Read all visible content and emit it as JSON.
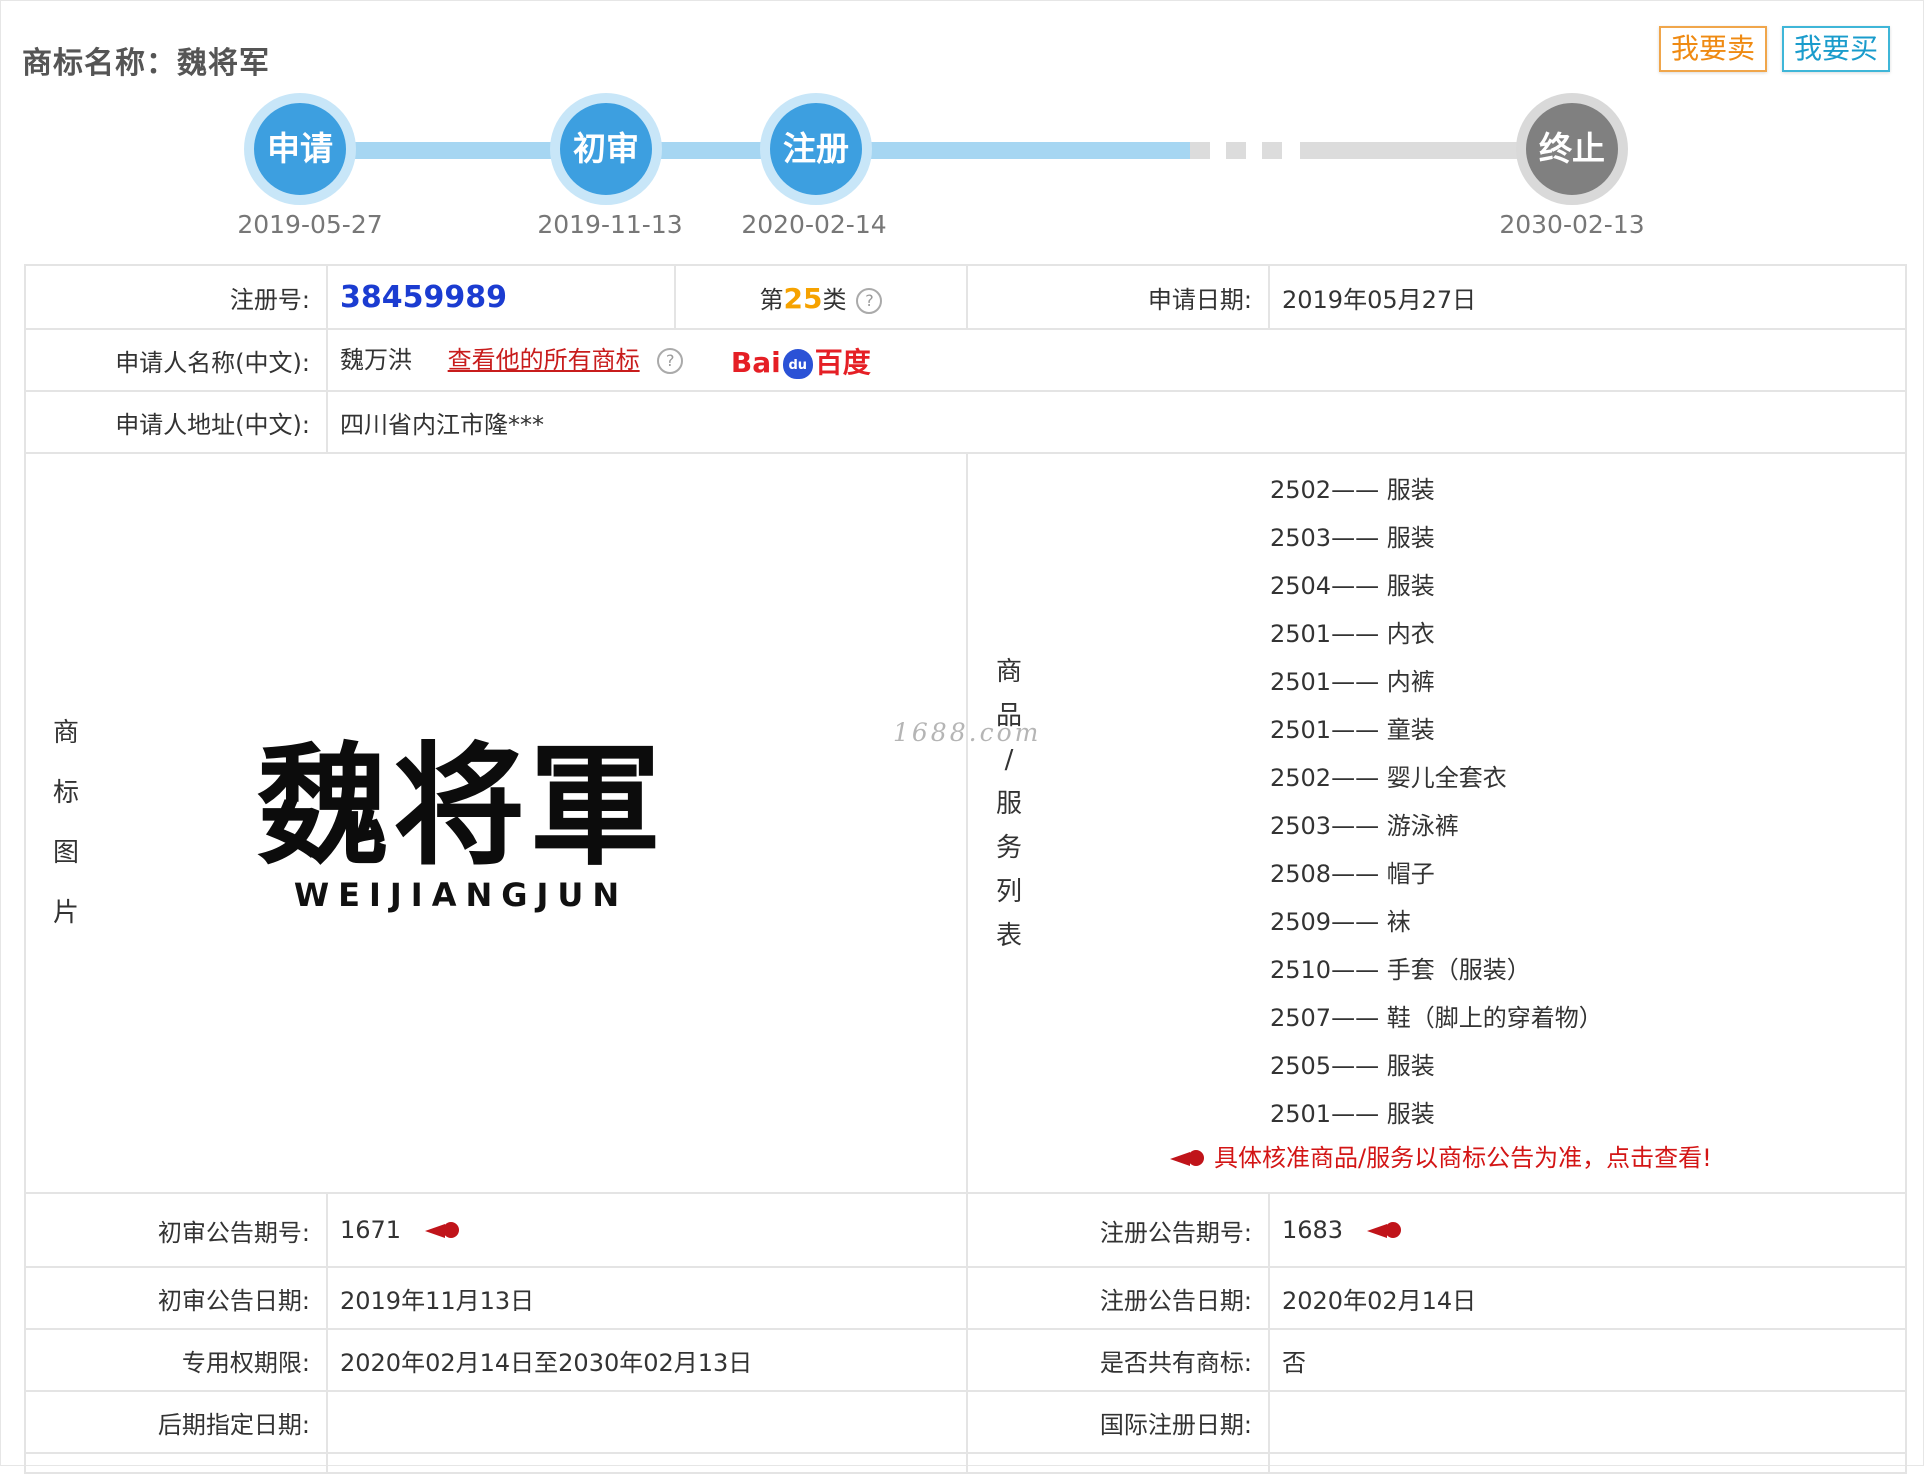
{
  "header": {
    "title": "商标名称：魏将军",
    "sell_button": "我要卖",
    "buy_button": "我要买"
  },
  "timeline": {
    "steps": [
      {
        "label": "申请",
        "date": "2019-05-27"
      },
      {
        "label": "初审",
        "date": "2019-11-13"
      },
      {
        "label": "注册",
        "date": "2020-02-14"
      },
      {
        "label": "终止",
        "date": "2030-02-13"
      }
    ]
  },
  "info": {
    "reg_no_label": "注册号:",
    "reg_no": "38459989",
    "class_prefix": "第",
    "class_num": "25",
    "class_suffix": "类",
    "help_icon": "?",
    "apply_date_label": "申请日期:",
    "apply_date": "2019年05月27日",
    "applicant_label": "申请人名称(中文):",
    "applicant": "魏万洪",
    "applicant_link": "查看他的所有商标",
    "baidu_text_left": "Bai",
    "baidu_paw": "du",
    "baidu_text_right": "百度",
    "address_label": "申请人地址(中文):",
    "address": "四川省内江市隆***",
    "image_label": [
      "商",
      "标",
      "图",
      "片"
    ],
    "logo_cn": "魏将軍",
    "logo_en": "WEIJIANGJUN",
    "watermark": "1688.com",
    "services_label": [
      "商",
      "品",
      "/",
      "服",
      "务",
      "列",
      "表"
    ],
    "services": [
      "2502—— 服装",
      "2503—— 服装",
      "2504—— 服装",
      "2501—— 内衣",
      "2501—— 内裤",
      "2501—— 童装",
      "2502—— 婴儿全套衣",
      "2503—— 游泳裤",
      "2508—— 帽子",
      "2509—— 袜",
      "2510—— 手套（服装）",
      "2507—— 鞋（脚上的穿着物）",
      "2505—— 服装",
      "2501—— 服装"
    ],
    "notice": "具体核准商品/服务以商标公告为准，点击查看!",
    "prelim_no_label": "初审公告期号:",
    "prelim_no": "1671",
    "reg_announce_no_label": "注册公告期号:",
    "reg_announce_no": "1683",
    "prelim_date_label": "初审公告日期:",
    "prelim_date": "2019年11月13日",
    "reg_announce_date_label": "注册公告日期:",
    "reg_announce_date": "2020年02月14日",
    "exclusive_label": "专用权期限:",
    "exclusive": "2020年02月14日至2030年02月13日",
    "shared_label": "是否共有商标:",
    "shared": "否",
    "later_label": "后期指定日期:",
    "later": "",
    "intl_label": "国际注册日期:",
    "intl": ""
  },
  "colors": {
    "accent_blue": "#3d9fe0",
    "link_red": "#c81c1c",
    "reg_no_blue": "#1b3cd1",
    "class_orange": "#f6a200"
  }
}
